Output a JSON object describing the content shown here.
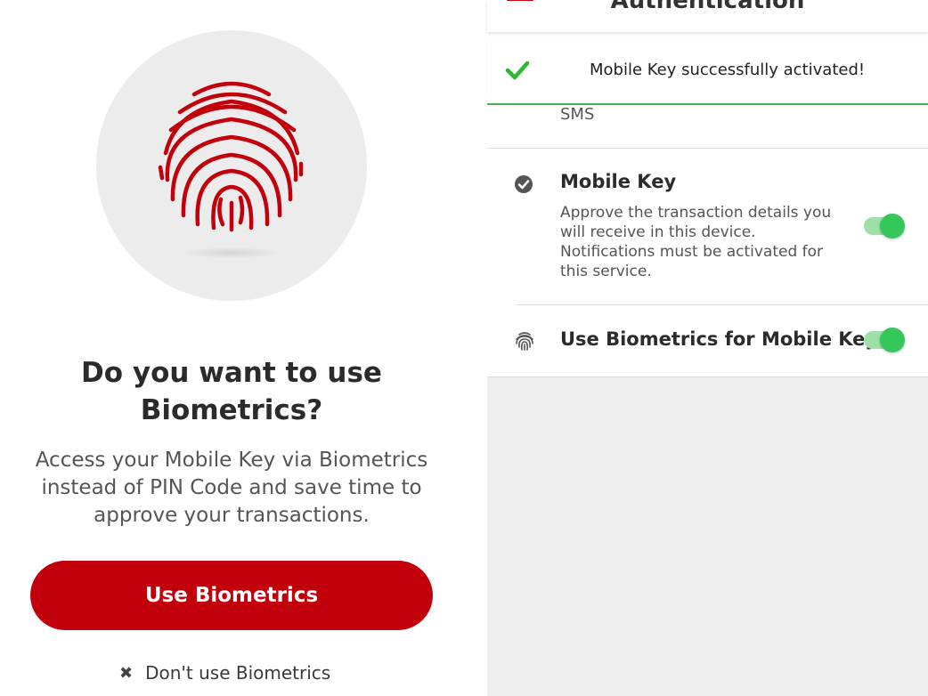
{
  "left_screen": {
    "question_title": "Do you want to use Biometrics?",
    "description": "Access your Mobile Key via Biometrics instead of PIN Code and save time to approve your transactions.",
    "primary_button_label": "Use Biometrics",
    "secondary_link_label": "Don't use Biometrics",
    "secondary_link_icon": "close-icon",
    "illustration_icon": "fingerprint-icon",
    "accent_color": "#c1000b"
  },
  "right_screen": {
    "appbar_title": "Authentication",
    "menu_icon": "hamburger-icon",
    "toast": {
      "message": "Mobile Key successfully activated!",
      "icon": "check-icon",
      "color": "#2eb82e"
    },
    "sms_label": "SMS",
    "mobile_key": {
      "title": "Mobile Key",
      "description": "Approve the transaction details you will receive in this device. Notifications must be activated for this service.",
      "icon": "check-circle-icon",
      "enabled": true
    },
    "biometrics": {
      "title": "Use Biometrics for Mobile Key",
      "icon": "fingerprint-icon",
      "enabled": true
    },
    "toggle_color": "#34c759"
  }
}
